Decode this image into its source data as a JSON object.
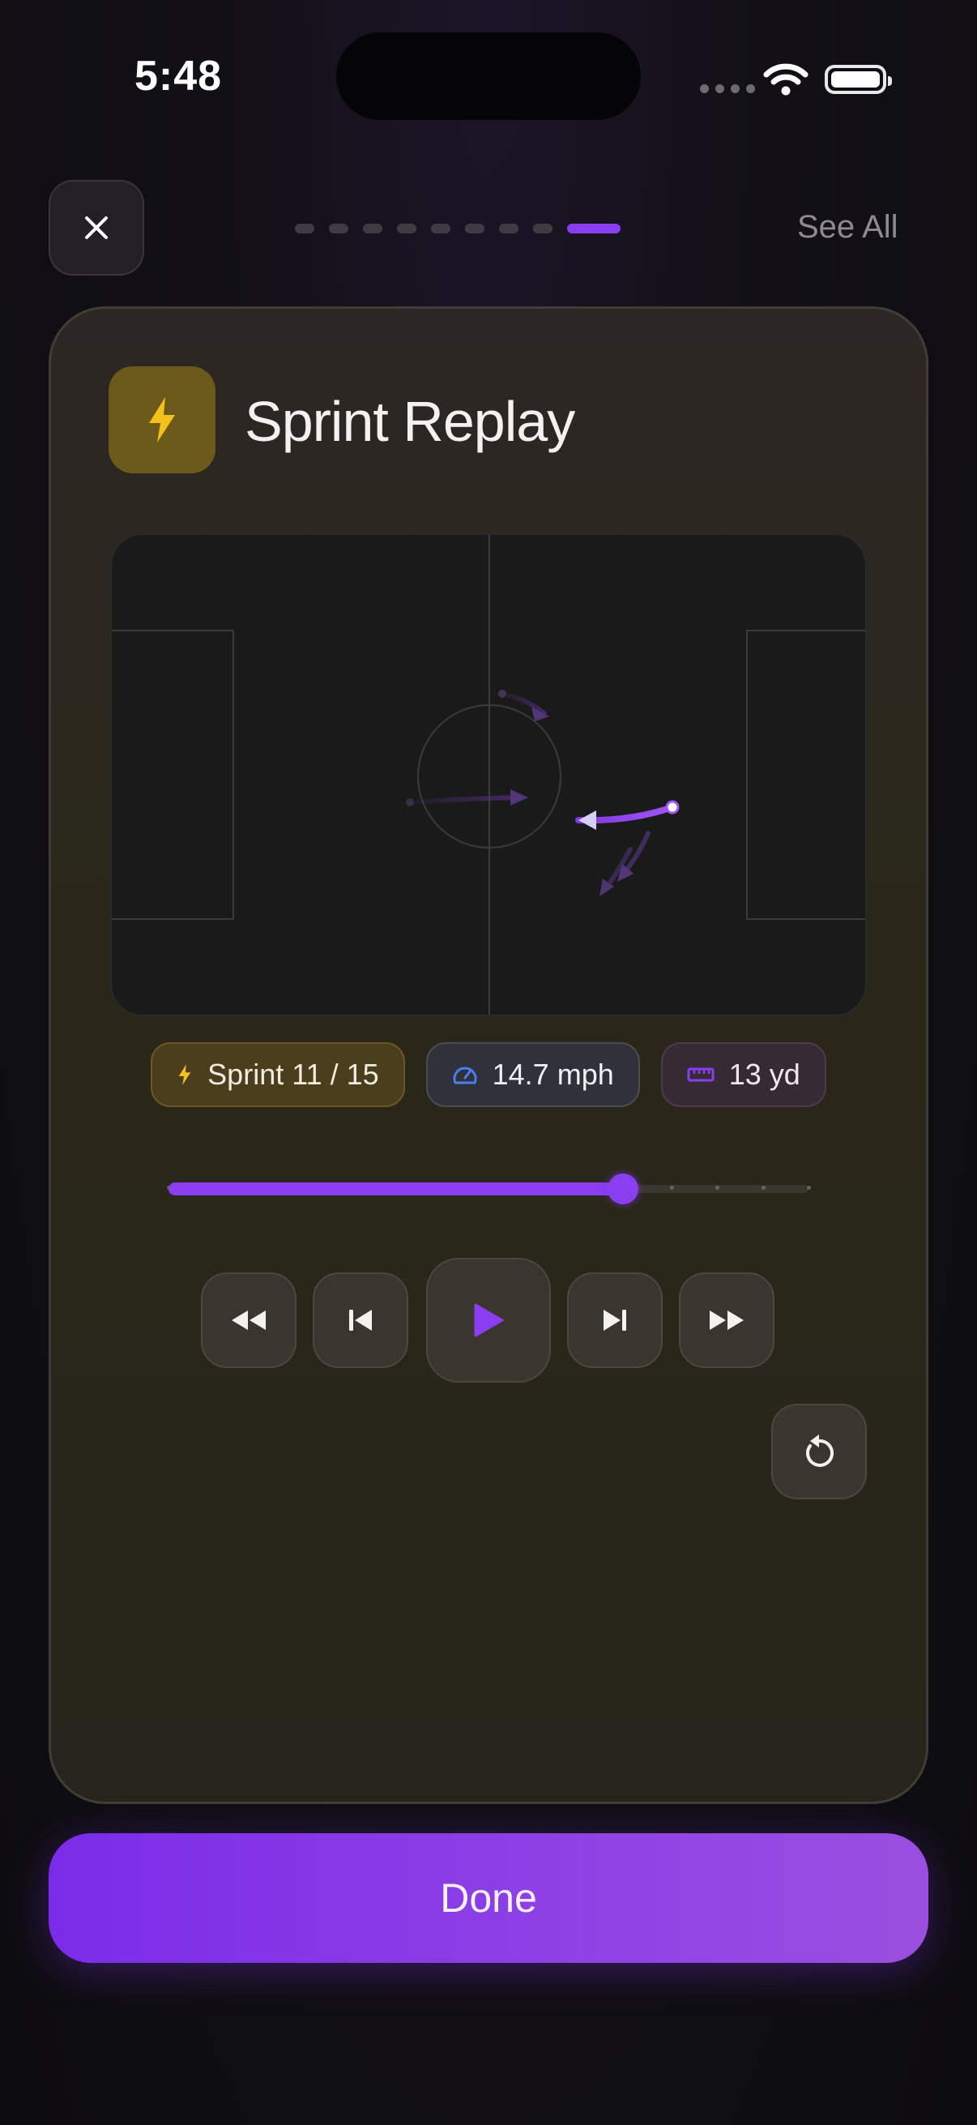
{
  "status_bar": {
    "time": "5:48"
  },
  "header": {
    "close_icon": "close-icon",
    "progress": {
      "total": 9,
      "active_index": 8
    },
    "see_all_label": "See All"
  },
  "card": {
    "icon": "lightning-icon",
    "title": "Sprint Replay",
    "chips": {
      "sprint": {
        "icon": "lightning-icon",
        "label": "Sprint 11 / 15"
      },
      "speed": {
        "icon": "speedometer-icon",
        "label": "14.7 mph"
      },
      "distance": {
        "icon": "ruler-icon",
        "label": "13 yd"
      }
    },
    "timeline": {
      "progress": 0.71,
      "tick_count": 15
    },
    "controls": {
      "rewind_icon": "rewind-icon",
      "previous_icon": "skip-previous-icon",
      "play_icon": "play-icon",
      "next_icon": "skip-next-icon",
      "fast_forward_icon": "fast-forward-icon",
      "replay_icon": "replay-icon"
    }
  },
  "footer": {
    "done_label": "Done"
  },
  "colors": {
    "accent": "#8b3df0",
    "sprint_yellow": "#f2c21b",
    "speed_blue": "#4a7ef0"
  }
}
